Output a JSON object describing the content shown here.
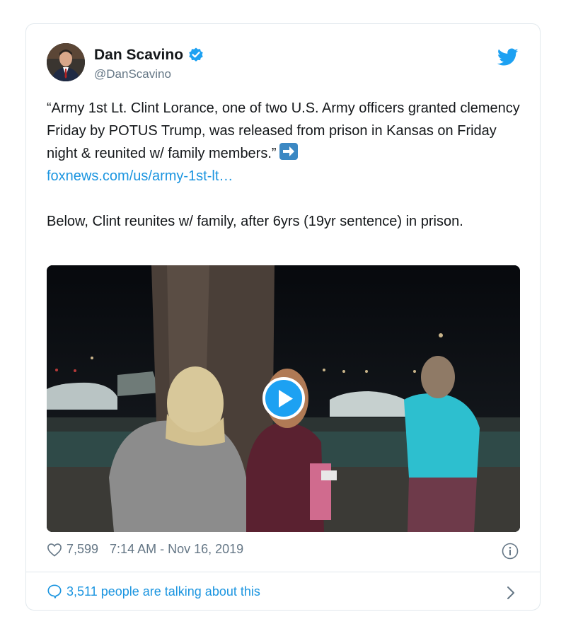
{
  "tweet": {
    "author_name": "Dan Scavino",
    "author_handle": "@DanScavino",
    "text_para1": "“Army 1st Lt. Clint Lorance, one of two U.S. Army officers granted clemency Friday by POTUS Trump, was released from prison in Kansas on Friday night & reunited w/ family members.”",
    "link_text": "foxnews.com/us/army-1st-lt…",
    "text_para2": "Below, Clint reunites w/ family, after 6yrs (19yr sentence) in prison.",
    "likes": "7,599",
    "timestamp": "7:14 AM - Nov 16, 2019",
    "talking": "3,511 people are talking about this"
  },
  "icons": {
    "verified": "verified-badge-icon",
    "brand": "twitter-bird-icon",
    "arrow": "right-arrow-emoji",
    "play": "play-icon",
    "like": "heart-icon",
    "info": "info-icon",
    "comment": "speech-bubble-icon",
    "chevron": "chevron-right-icon"
  },
  "colors": {
    "twitter_blue": "#1da1f2",
    "link_blue": "#1b95e0",
    "text": "#14171a",
    "secondary": "#657786",
    "border": "#e1e8ed"
  }
}
